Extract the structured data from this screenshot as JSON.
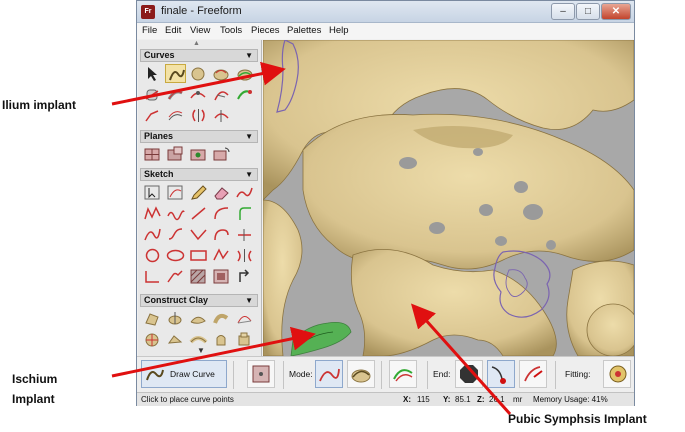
{
  "window": {
    "app_icon": "Fr",
    "title": "finale - Freeform",
    "min_glyph": "–",
    "max_glyph": "□",
    "close_glyph": "✕"
  },
  "menu": [
    "File",
    "Edit",
    "View",
    "Tools",
    "Pieces",
    "Palettes",
    "Help"
  ],
  "palettes": {
    "curves": "Curves",
    "planes": "Planes",
    "sketch": "Sketch",
    "construct_clay": "Construct Clay",
    "drop_glyph": "▼"
  },
  "bottombar": {
    "draw_curve": "Draw Curve",
    "mode_label": "Mode:",
    "end_label": "End:",
    "fitting_label": "Fitting:"
  },
  "status": {
    "hint": "Click to place curve points",
    "x_label": "X:",
    "x": "115",
    "y_label": "Y:",
    "y": "85.1",
    "z_label": "Z:",
    "z": "26.1",
    "units": "mr",
    "memory": "Memory Usage: 41%"
  },
  "annotations": {
    "ilium": "Ilium  implant",
    "ischium_line1": "Ischium",
    "ischium_line2": "Implant",
    "pubic": "Pubic Symphsis Implant"
  },
  "colors": {
    "bone": "#d9c48f",
    "arrow": "#e01010",
    "implant_outline": "#7b64b0",
    "ischium_fill": "#47b346"
  }
}
